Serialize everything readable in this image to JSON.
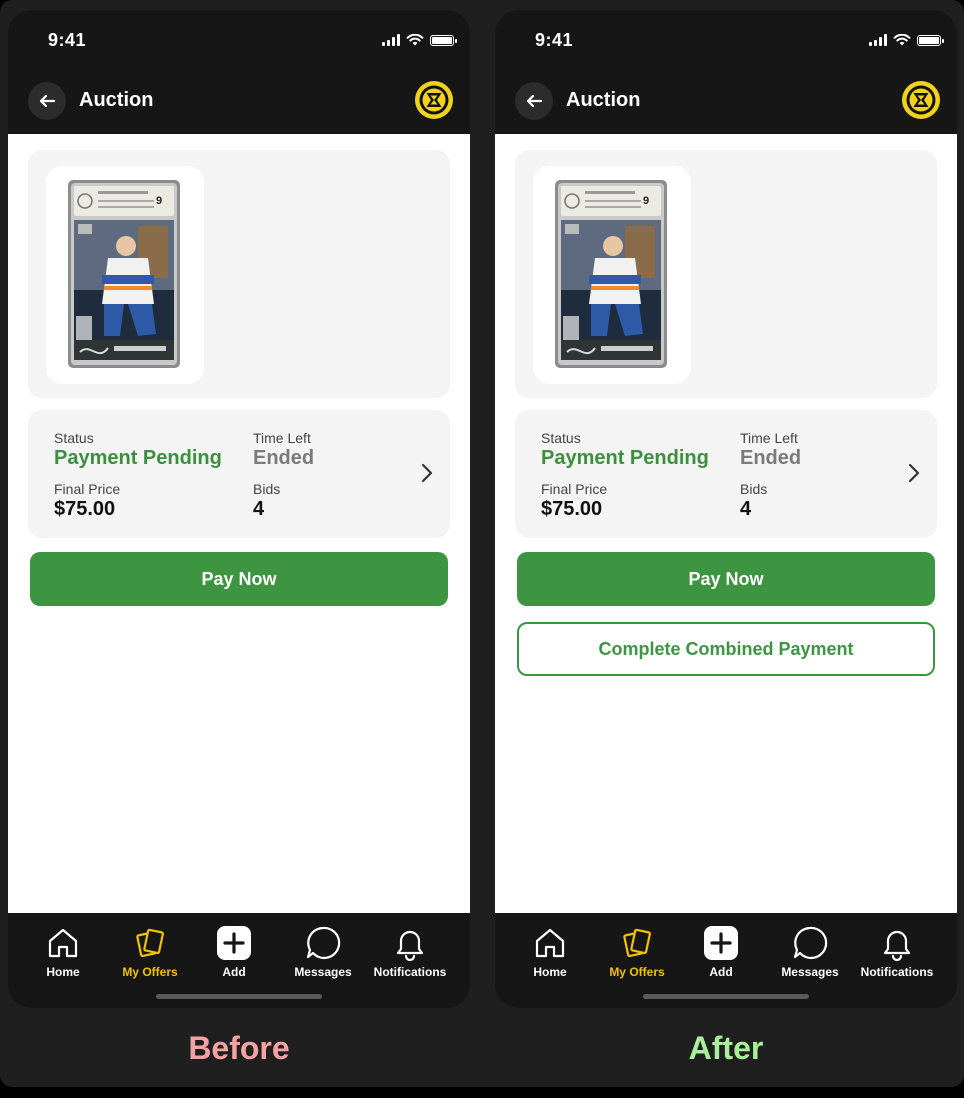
{
  "statusbar": {
    "time": "9:41"
  },
  "header": {
    "title": "Auction"
  },
  "listing": {
    "grade": "9",
    "status_label": "Status",
    "status_value": "Payment Pending",
    "time_left_label": "Time Left",
    "time_left_value": "Ended",
    "final_price_label": "Final Price",
    "final_price_value": "$75.00",
    "bids_label": "Bids",
    "bids_value": "4"
  },
  "actions": {
    "pay_now": "Pay Now",
    "combined_payment": "Complete Combined Payment"
  },
  "tabs": [
    {
      "label": "Home",
      "icon": "home-icon",
      "active": false
    },
    {
      "label": "My Offers",
      "icon": "cards-icon",
      "active": true
    },
    {
      "label": "Add",
      "icon": "plus-icon",
      "active": false
    },
    {
      "label": "Messages",
      "icon": "chat-bubble-icon",
      "active": false
    },
    {
      "label": "Notifications",
      "icon": "bell-icon",
      "active": false
    }
  ],
  "captions": {
    "before": "Before",
    "after": "After"
  },
  "colors": {
    "brand_green": "#3d9441",
    "status_green": "#3b8f3e",
    "active_tab": "#f2c200",
    "logo_yellow": "#f2d21b",
    "caption_before": "#f4a3a3",
    "caption_after": "#a8f09a"
  }
}
